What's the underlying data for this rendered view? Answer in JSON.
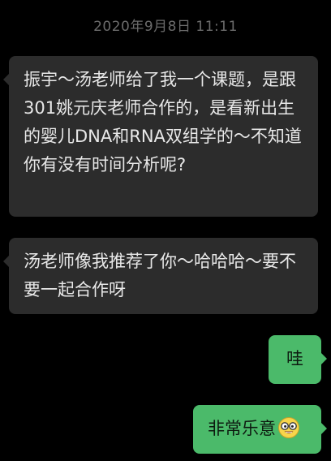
{
  "chat": {
    "timestamp": "2020年9月8日 11:11",
    "messages": [
      {
        "direction": "incoming",
        "text": "振宇～汤老师给了我一个课题，是跟301姚元庆老师合作的，是看新出生的婴儿DNA和RNA双组学的～不知道你有没有时间分析呢?"
      },
      {
        "direction": "incoming",
        "text": "汤老师像我推荐了你～哈哈哈～要不要一起合作呀"
      },
      {
        "direction": "outgoing",
        "text": "哇"
      },
      {
        "direction": "outgoing",
        "text": "非常乐意",
        "emoji": "grinning-glasses-emoji"
      }
    ]
  },
  "colors": {
    "background": "#000000",
    "incoming_bubble": "#2c2c2c",
    "outgoing_bubble": "#4bba6a",
    "timestamp_text": "#6b6b6b"
  }
}
